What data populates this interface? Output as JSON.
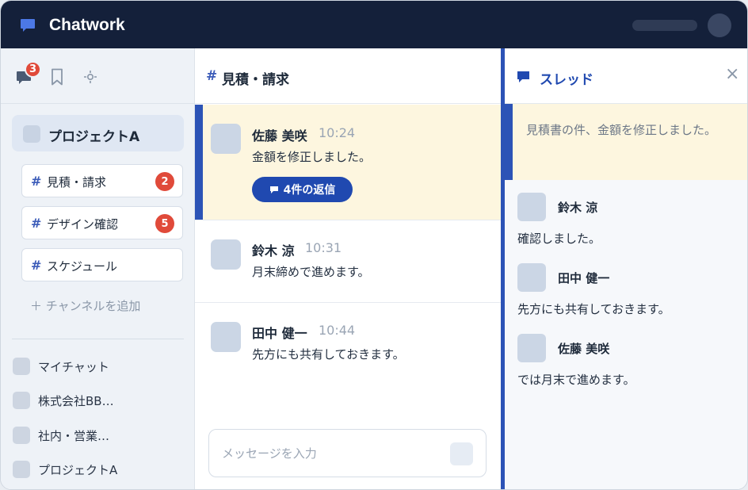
{
  "app": {
    "title": "Chatwork"
  },
  "sidebar": {
    "unread_count": "3",
    "project": {
      "label": "プロジェクトA"
    },
    "channels": [
      {
        "label": "見積・請求",
        "badge": "2"
      },
      {
        "label": "デザイン確認",
        "badge": "5"
      },
      {
        "label": "スケジュール",
        "badge": ""
      }
    ],
    "add_channel_label": "＋ チャンネルを追加",
    "direct_items": [
      {
        "label": "マイチャット"
      },
      {
        "label": "株式会社BB…"
      },
      {
        "label": "社内・営業…"
      },
      {
        "label": "プロジェクトA"
      }
    ]
  },
  "main": {
    "channel_hash": "#",
    "channel_title": "見積・請求",
    "messages": [
      {
        "name": "佐藤 美咲",
        "time": "10:24",
        "text": "金額を修正しました。",
        "reply_label": "4件の返信"
      },
      {
        "name": "鈴木 涼",
        "time": "10:31",
        "text": "月末締めで進めます。"
      },
      {
        "name": "田中 健一",
        "time": "10:44",
        "text": "先方にも共有しておきます。"
      }
    ],
    "composer": {
      "placeholder": "メッセージを入力"
    }
  },
  "thread": {
    "title": "スレッド",
    "close_symbol": "×",
    "origin_text": "見積書の件、金額を修正しました。",
    "replies": [
      {
        "name": "鈴木 涼",
        "text": "確認しました。"
      },
      {
        "name": "田中 健一",
        "text": "先方にも共有しておきます。"
      },
      {
        "name": "佐藤 美咲",
        "text": "では月末で進めます。"
      }
    ]
  },
  "colors": {
    "topbar": "#14203a",
    "accent": "#2c53b6",
    "badge": "#e04a3a",
    "highlight": "#fdf6df"
  },
  "icons": {
    "logo": "chat-bubble-icon",
    "chats": "chat-bubble-icon",
    "bookmark": "bookmark-icon",
    "locate": "locate-icon",
    "thread": "thread-icon",
    "close": "close-icon"
  }
}
